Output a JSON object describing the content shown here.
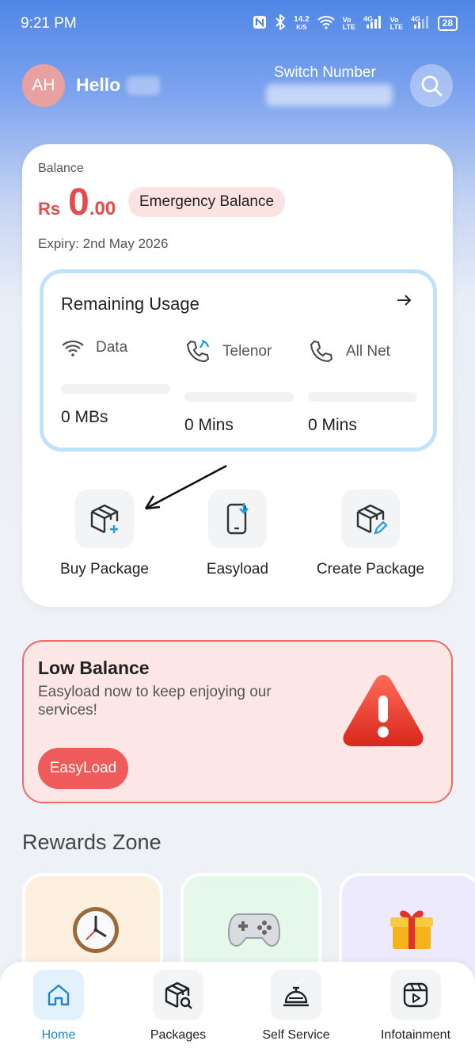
{
  "status_bar": {
    "time": "9:21 PM",
    "net_speed": "14.2",
    "net_unit": "K/S",
    "volte1": "Vo LTE",
    "lte1": "4G",
    "volte2": "Vo LTE",
    "lte2": "4G",
    "battery": "28"
  },
  "header": {
    "avatar_initials": "AH",
    "greeting": "Hello",
    "switch_number_label": "Switch Number"
  },
  "balance": {
    "label": "Balance",
    "currency": "Rs",
    "whole": "0",
    "decimal": ".00",
    "emergency_label": "Emergency Balance",
    "expiry": "Expiry: 2nd May 2026"
  },
  "usage": {
    "title": "Remaining Usage",
    "columns": [
      {
        "label": "Data",
        "value": "0 MBs"
      },
      {
        "label": "Telenor",
        "value": "0 Mins"
      },
      {
        "label": "All Net",
        "value": "0 Mins"
      }
    ]
  },
  "quick_actions": [
    {
      "label": "Buy Package"
    },
    {
      "label": "Easyload"
    },
    {
      "label": "Create Package"
    }
  ],
  "low_balance": {
    "title": "Low Balance",
    "text": "Easyload now to keep enjoying our services!",
    "button": "EasyLoad"
  },
  "rewards": {
    "title": "Rewards Zone",
    "cards": [
      {
        "icon": "clock-icon",
        "color": "#fdf0de"
      },
      {
        "icon": "gamepad-icon",
        "color": "#e6f8ea"
      },
      {
        "icon": "gift-icon",
        "color": "#eceafc"
      }
    ]
  },
  "nav": [
    {
      "label": "Home",
      "active": true
    },
    {
      "label": "Packages"
    },
    {
      "label": "Self Service"
    },
    {
      "label": "Infotainment"
    }
  ],
  "colors": {
    "accent_red": "#e54b4b",
    "accent_blue": "#1d86d1"
  }
}
